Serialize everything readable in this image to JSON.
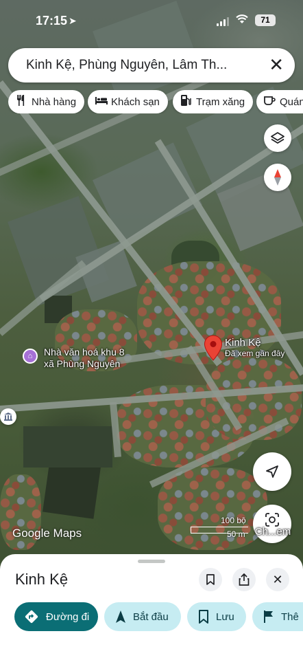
{
  "status": {
    "time": "17:15",
    "battery": "71"
  },
  "search": {
    "query": "Kinh Kệ, Phùng Nguyên, Lâm Th..."
  },
  "chips": [
    {
      "label": "Nhà hàng",
      "icon": "fork-knife-icon"
    },
    {
      "label": "Khách sạn",
      "icon": "bed-icon"
    },
    {
      "label": "Trạm xăng",
      "icon": "gas-station-icon"
    },
    {
      "label": "Quán",
      "icon": "coffee-icon"
    }
  ],
  "map": {
    "pin_title": "Kinh Kệ",
    "pin_subtitle": "Đã xem gần đây",
    "poi_line1": "Nhà văn hoá khu 8",
    "poi_line2": "xã Phùng Nguyên",
    "watermark": "Google Maps",
    "scale_top": "100 bộ",
    "scale_bottom": "50 m",
    "lens_label": "Ch...em"
  },
  "sheet": {
    "title": "Kinh Kệ",
    "actions": [
      {
        "label": "Đường đi",
        "icon": "directions-icon"
      },
      {
        "label": "Bắt đầu",
        "icon": "navigation-arrow-icon"
      },
      {
        "label": "Lưu",
        "icon": "bookmark-icon"
      },
      {
        "label": "Thê",
        "icon": "flag-icon"
      }
    ]
  },
  "colors": {
    "primary": "#0b6e75",
    "secondary": "#c6ecf2",
    "pin": "#ea4335"
  }
}
